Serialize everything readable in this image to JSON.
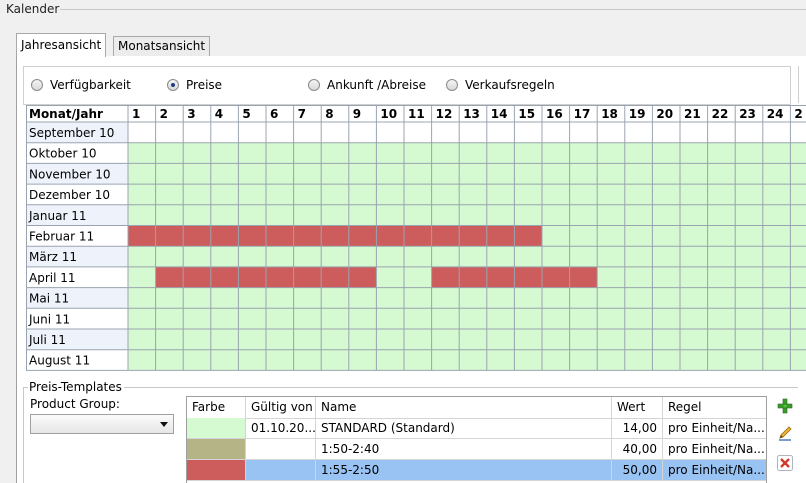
{
  "window": {
    "group_title": "Kalender"
  },
  "tabs": [
    {
      "label": "Jahresansicht",
      "active": true
    },
    {
      "label": "Monatsansicht",
      "active": false
    }
  ],
  "view_options": [
    {
      "label": "Verfügbarkeit",
      "checked": false
    },
    {
      "label": "Preise",
      "checked": true
    },
    {
      "label": "Ankunft /Abreise",
      "checked": false
    },
    {
      "label": "Verkaufsregeln",
      "checked": false
    }
  ],
  "calendar": {
    "corner_header": "Monat/Jahr",
    "day_headers": [
      "1",
      "2",
      "3",
      "4",
      "5",
      "6",
      "7",
      "8",
      "9",
      "10",
      "11",
      "12",
      "13",
      "14",
      "15",
      "16",
      "17",
      "18",
      "19",
      "20",
      "21",
      "22",
      "23",
      "24",
      "2"
    ],
    "colors": {
      "available": "#d5f9d0",
      "priced": "#cd5c5c",
      "empty": "#ffffff",
      "grid": "#9aa4b0",
      "row_header_alt": "#eef3fb"
    },
    "rows": [
      {
        "label": "September 10",
        "cells": "wwwwwwwwwwwwwwwwwwwwwwwww"
      },
      {
        "label": "Oktober 10",
        "cells": "ggggggggggggggggggggggggg"
      },
      {
        "label": "November 10",
        "cells": "ggggggggggggggggggggggggg"
      },
      {
        "label": "Dezember 10",
        "cells": "ggggggggggggggggggggggggg"
      },
      {
        "label": "Januar 11",
        "cells": "ggggggggggggggggggggggggg"
      },
      {
        "label": "Februar 11",
        "cells": "rrrrrrrrrrrrrrrgggggggggg"
      },
      {
        "label": "März 11",
        "cells": "ggggggggggggggggggggggggg"
      },
      {
        "label": "April 11",
        "cells": "grrrrrrrrggrrrrrrgggggggg"
      },
      {
        "label": "Mai 11",
        "cells": "ggggggggggggggggggggggggg"
      },
      {
        "label": "Juni 11",
        "cells": "ggggggggggggggggggggggggg"
      },
      {
        "label": "Juli 11",
        "cells": "ggggggggggggggggggggggggg"
      },
      {
        "label": "August 11",
        "cells": "ggggggggggggggggggggggggg"
      }
    ]
  },
  "templates": {
    "title": "Preis-Templates",
    "product_group_label": "Product Group:",
    "product_group_value": "",
    "columns": [
      "Farbe",
      "Gültig von",
      "Name",
      "Wert",
      "Regel"
    ],
    "rows": [
      {
        "color": "#d5f9d0",
        "valid_from": "01.10.20...",
        "name": "STANDARD (Standard)",
        "value": "14,00",
        "rule": "pro Einheit/Na...",
        "selected": false
      },
      {
        "color": "#b5b487",
        "valid_from": "",
        "name": "1:50-2:40",
        "value": "40,00",
        "rule": "pro Einheit/Na...",
        "selected": false
      },
      {
        "color": "#cd5c5c",
        "valid_from": "",
        "name": "1:55-2:50",
        "value": "50,00",
        "rule": "pro Einheit/Na...",
        "selected": true
      }
    ],
    "actions": [
      {
        "name": "add-template-button",
        "icon": "plus-icon"
      },
      {
        "name": "edit-template-button",
        "icon": "pencil-icon"
      },
      {
        "name": "delete-template-button",
        "icon": "delete-x-icon"
      }
    ]
  }
}
